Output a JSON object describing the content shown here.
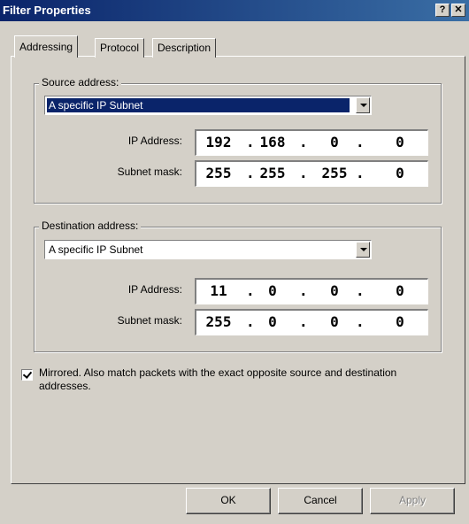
{
  "window": {
    "title": "Filter Properties"
  },
  "titlebar_buttons": {
    "help": "?",
    "close": "✕"
  },
  "tabs": [
    {
      "label": "Addressing",
      "active": true
    },
    {
      "label": "Protocol",
      "active": false
    },
    {
      "label": "Description",
      "active": false
    }
  ],
  "source": {
    "group_label": "Source address:",
    "type_value": "A specific IP Subnet",
    "ip_label": "IP Address:",
    "ip_octets": [
      "192",
      "168",
      "0",
      "0"
    ],
    "mask_label": "Subnet mask:",
    "mask_octets": [
      "255",
      "255",
      "255",
      "0"
    ]
  },
  "destination": {
    "group_label": "Destination address:",
    "type_value": "A specific IP Subnet",
    "ip_label": "IP Address:",
    "ip_octets": [
      "11",
      "0",
      "0",
      "0"
    ],
    "mask_label": "Subnet mask:",
    "mask_octets": [
      "255",
      "0",
      "0",
      "0"
    ]
  },
  "mirrored": {
    "checked": true,
    "label": "Mirrored. Also match packets with the exact opposite source and destination addresses."
  },
  "buttons": {
    "ok": "OK",
    "cancel": "Cancel",
    "apply": "Apply"
  },
  "icons": {
    "dropdown": "chevron-down-icon",
    "help": "help-icon",
    "close": "close-icon"
  },
  "colors": {
    "face": "#d4d0c8",
    "title_start": "#0a246a",
    "title_end": "#3a6ea5",
    "selection": "#0a246a"
  }
}
